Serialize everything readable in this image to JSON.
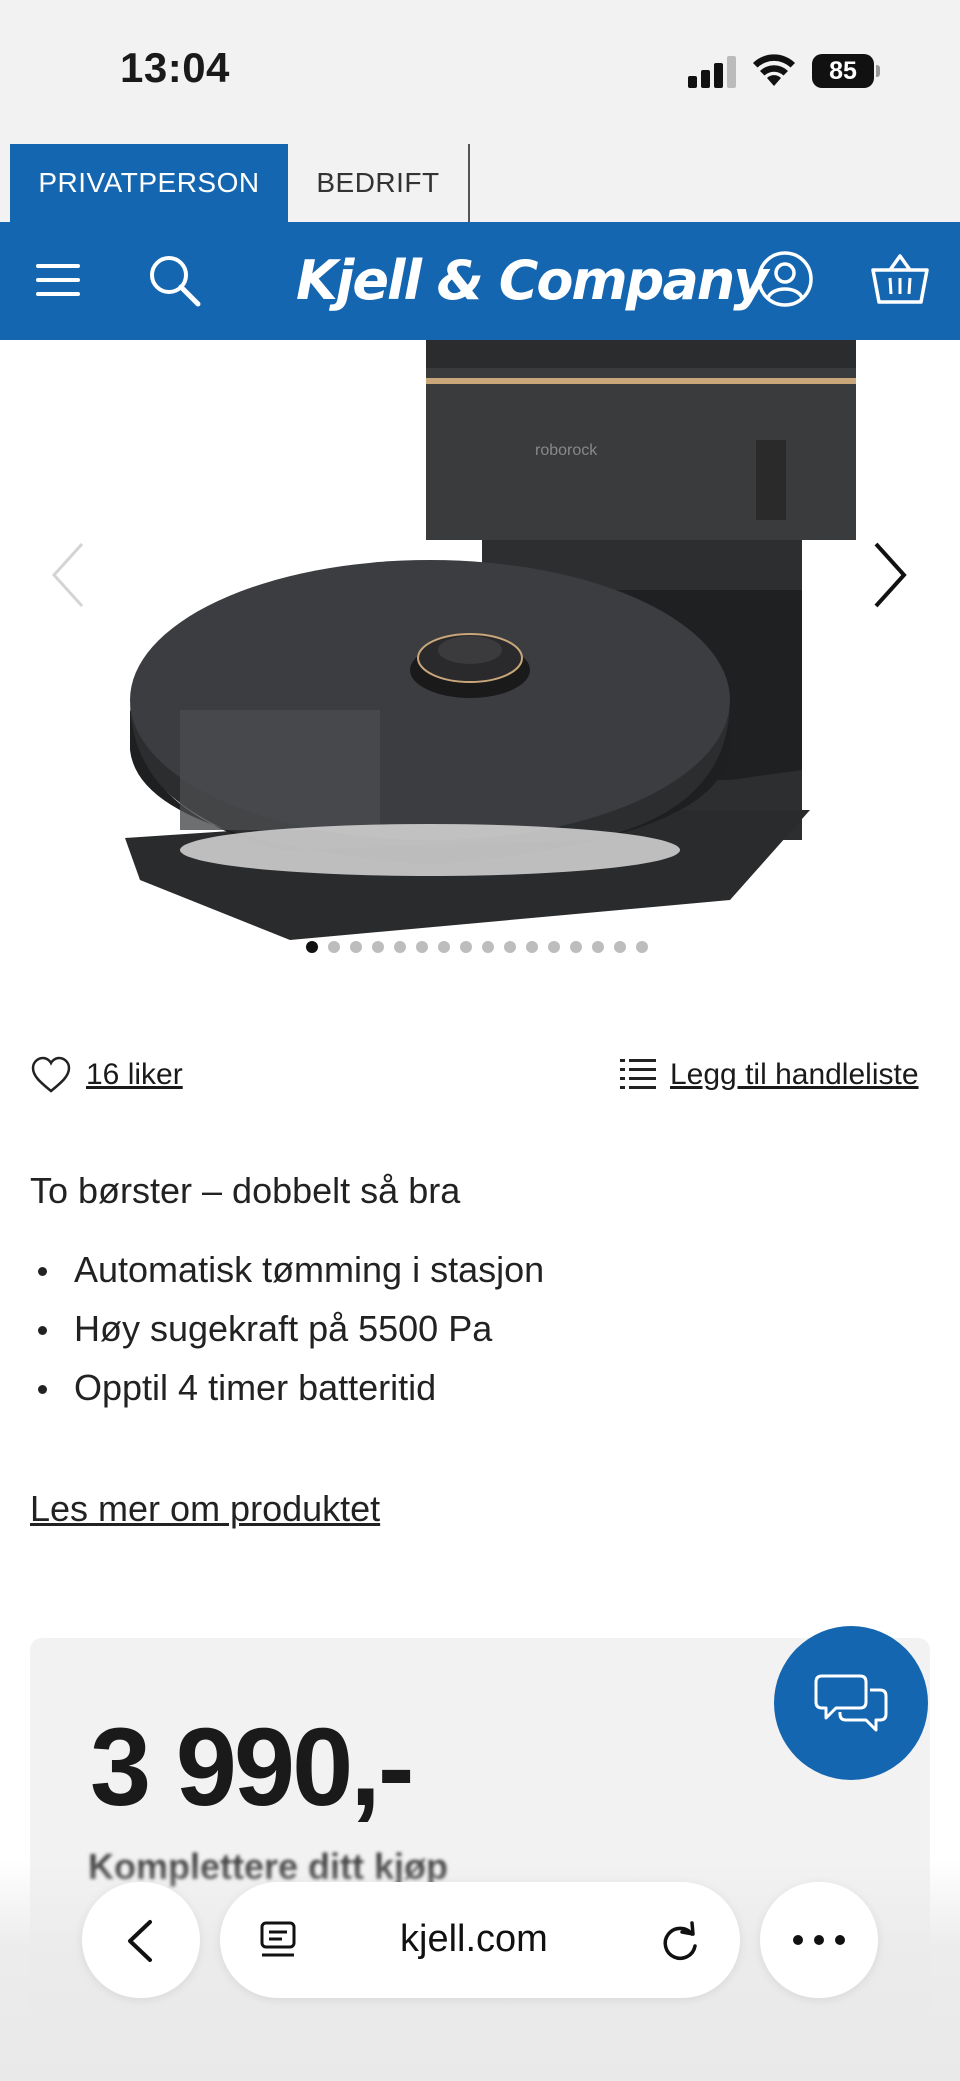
{
  "status_bar": {
    "time": "13:04",
    "battery": "85"
  },
  "segment_tabs": {
    "private": "PRIVATPERSON",
    "business": "BEDRIFT"
  },
  "header": {
    "logo": "Kjell & Company"
  },
  "gallery": {
    "slide_count": 16,
    "active_slide": 1
  },
  "actions": {
    "likes": "16 liker",
    "add_to_list": "Legg til handleliste"
  },
  "product": {
    "tagline": "To børster – dobbelt så bra",
    "bullets": [
      "Automatisk tømming i stasjon",
      "Høy sugekraft på 5500 Pa",
      "Opptil 4 timer batteritid"
    ],
    "read_more": "Les mer om produktet",
    "price": "3 990,-",
    "complete_purchase": "Komplettere ditt kjøp"
  },
  "browser": {
    "url": "kjell.com"
  },
  "colors": {
    "brand_blue": "#1466b0",
    "background": "#ffffff",
    "card": "#f2f2f2"
  }
}
